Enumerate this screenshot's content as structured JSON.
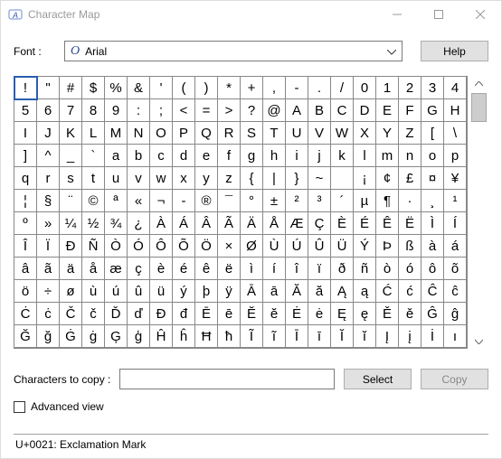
{
  "window": {
    "title": "Character Map"
  },
  "labels": {
    "font": "Font :",
    "help": "Help",
    "chars_to_copy": "Characters to copy :",
    "select": "Select",
    "copy": "Copy",
    "advanced_view": "Advanced view"
  },
  "font": {
    "prefix_glyph": "O",
    "name": "Arial"
  },
  "copy_field": {
    "value": ""
  },
  "advanced_view_checked": false,
  "status": "U+0021: Exclamation Mark",
  "selected_index": 0,
  "grid": [
    "!",
    "\"",
    "#",
    "$",
    "%",
    "&",
    "'",
    "(",
    ")",
    "*",
    "+",
    ",",
    "-",
    ".",
    "/",
    "0",
    "1",
    "2",
    "3",
    "4",
    "5",
    "6",
    "7",
    "8",
    "9",
    ":",
    ";",
    "<",
    "=",
    ">",
    "?",
    "@",
    "A",
    "B",
    "C",
    "D",
    "E",
    "F",
    "G",
    "H",
    "I",
    "J",
    "K",
    "L",
    "M",
    "N",
    "O",
    "P",
    "Q",
    "R",
    "S",
    "T",
    "U",
    "V",
    "W",
    "X",
    "Y",
    "Z",
    "[",
    "\\",
    "]",
    "^",
    "_",
    "`",
    "a",
    "b",
    "c",
    "d",
    "e",
    "f",
    "g",
    "h",
    "i",
    "j",
    "k",
    "l",
    "m",
    "n",
    "o",
    "p",
    "q",
    "r",
    "s",
    "t",
    "u",
    "v",
    "w",
    "x",
    "y",
    "z",
    "{",
    "|",
    "}",
    "~",
    " ",
    "¡",
    "¢",
    "£",
    "¤",
    "¥",
    "¦",
    "§",
    "¨",
    "©",
    "ª",
    "«",
    "¬",
    "-",
    "®",
    "¯",
    "°",
    "±",
    "²",
    "³",
    "´",
    "µ",
    "¶",
    "·",
    "¸",
    "¹",
    "º",
    "»",
    "¼",
    "½",
    "¾",
    "¿",
    "À",
    "Á",
    "Â",
    "Ã",
    "Ä",
    "Å",
    "Æ",
    "Ç",
    "È",
    "É",
    "Ê",
    "Ë",
    "Ì",
    "Í",
    "Î",
    "Ï",
    "Ð",
    "Ñ",
    "Ò",
    "Ó",
    "Ô",
    "Õ",
    "Ö",
    "×",
    "Ø",
    "Ù",
    "Ú",
    "Û",
    "Ü",
    "Ý",
    "Þ",
    "ß",
    "à",
    "á",
    "â",
    "ã",
    "ä",
    "å",
    "æ",
    "ç",
    "è",
    "é",
    "ê",
    "ë",
    "ì",
    "í",
    "î",
    "ï",
    "ð",
    "ñ",
    "ò",
    "ó",
    "ô",
    "õ",
    "ö",
    "÷",
    "ø",
    "ù",
    "ú",
    "û",
    "ü",
    "ý",
    "þ",
    "ÿ",
    "Ā",
    "ā",
    "Ă",
    "ă",
    "Ą",
    "ą",
    "Ć",
    "ć",
    "Ĉ",
    "ĉ",
    "Ċ",
    "ċ",
    "Č",
    "č",
    "Ď",
    "ď",
    "Đ",
    "đ",
    "Ē",
    "ē",
    "Ĕ",
    "ĕ",
    "Ė",
    "ė",
    "Ę",
    "ę",
    "Ě",
    "ě",
    "Ĝ",
    "ĝ",
    "Ğ",
    "ğ",
    "Ġ",
    "ġ",
    "Ģ",
    "ģ",
    "Ĥ",
    "ĥ",
    "Ħ",
    "ħ",
    "Ĩ",
    "ĩ",
    "Ī",
    "ī",
    "Ĭ",
    "ĭ",
    "Į",
    "į",
    "İ",
    "ı"
  ]
}
